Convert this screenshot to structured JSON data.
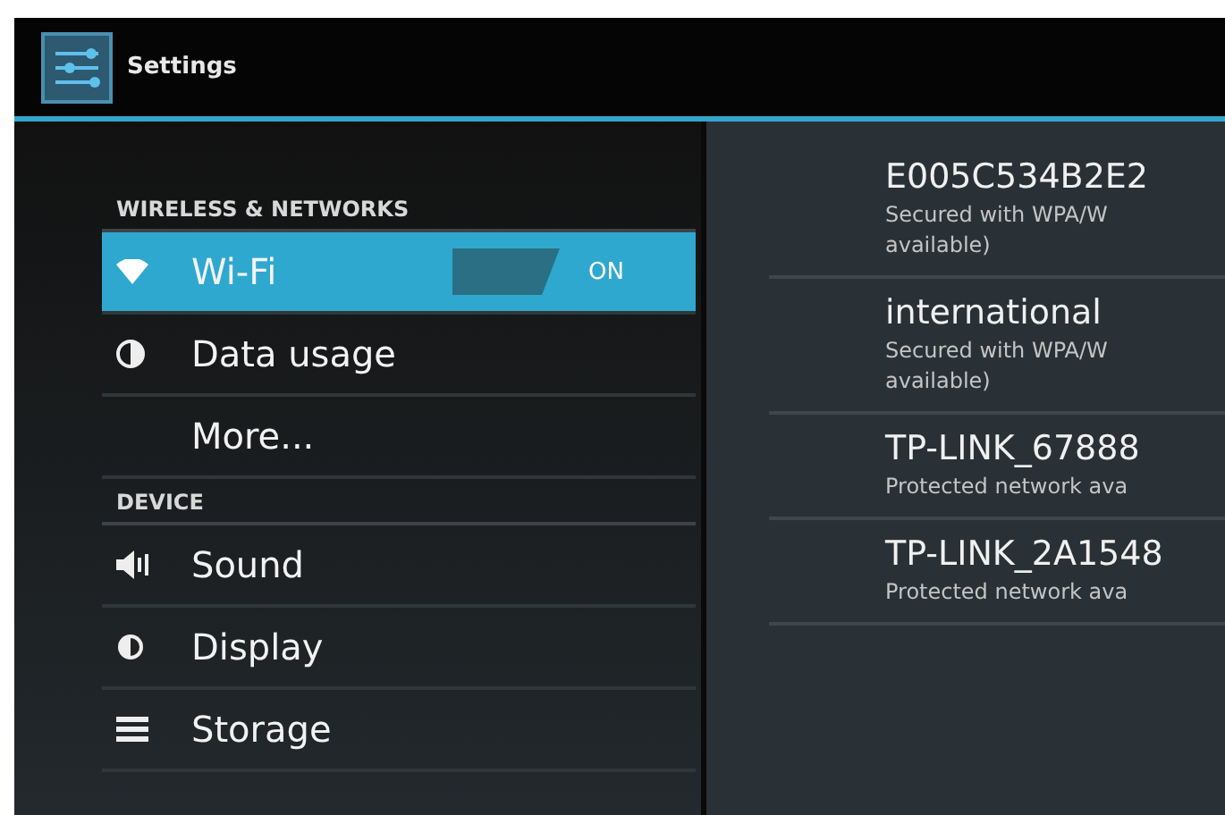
{
  "action_bar": {
    "title": "Settings"
  },
  "sections": [
    {
      "header": "WIRELESS & NETWORKS",
      "items": [
        {
          "label": "Wi-Fi",
          "selected": true,
          "switch": {
            "on": true,
            "label": "ON"
          }
        },
        {
          "label": "Data usage",
          "selected": false
        },
        {
          "label": "More...",
          "selected": false
        }
      ]
    },
    {
      "header": "DEVICE",
      "items": [
        {
          "label": "Sound",
          "selected": false
        },
        {
          "label": "Display",
          "selected": false
        },
        {
          "label": "Storage",
          "selected": false
        }
      ]
    }
  ],
  "networks": [
    {
      "name": "E005C534B2E2",
      "status": "Secured with WPA/W",
      "status_line_2": "available)"
    },
    {
      "name": "international",
      "status": "Secured with WPA/W",
      "status_line_2": "available)"
    },
    {
      "name": "TP-LINK_67888",
      "status": "Protected network ava"
    },
    {
      "name": "TP-LINK_2A1548",
      "status": "Protected network ava"
    }
  ]
}
